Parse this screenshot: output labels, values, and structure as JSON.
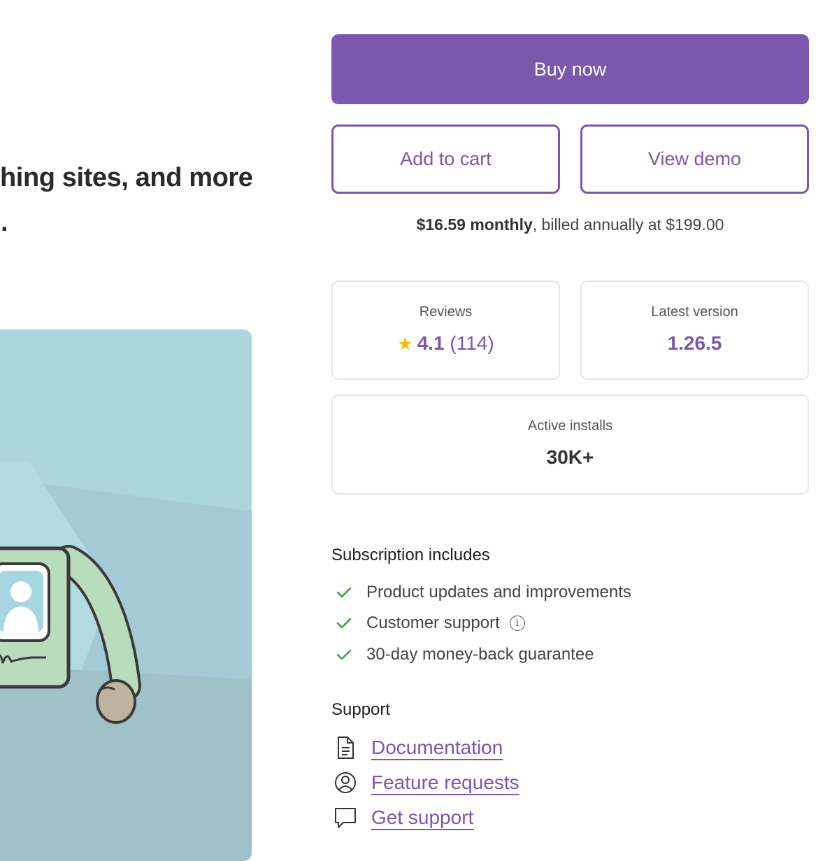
{
  "headline": {
    "line1": "hing sites, and more",
    "line2": "ts."
  },
  "actions": {
    "buy_now": "Buy now",
    "add_to_cart": "Add to cart",
    "view_demo": "View demo"
  },
  "pricing": {
    "monthly": "$16.59 monthly",
    "annual": ", billed annually at $199.00"
  },
  "stats": {
    "reviews_label": "Reviews",
    "rating": "4.1",
    "review_count": "(114)",
    "version_label": "Latest version",
    "version": "1.26.5",
    "installs_label": "Active installs",
    "installs": "30K+"
  },
  "subscription": {
    "title": "Subscription includes",
    "items": [
      "Product updates and improvements",
      "Customer support",
      "30-day money-back guarantee"
    ]
  },
  "support": {
    "title": "Support",
    "links": [
      "Documentation",
      "Feature requests",
      "Get support"
    ],
    "icons": [
      "document-icon",
      "user-circle-icon",
      "chat-bubble-icon"
    ]
  },
  "colors": {
    "accent": "#7b57ad",
    "star": "#f2c200",
    "check": "#3aa543",
    "hero_bg": "#a9d4dc"
  }
}
